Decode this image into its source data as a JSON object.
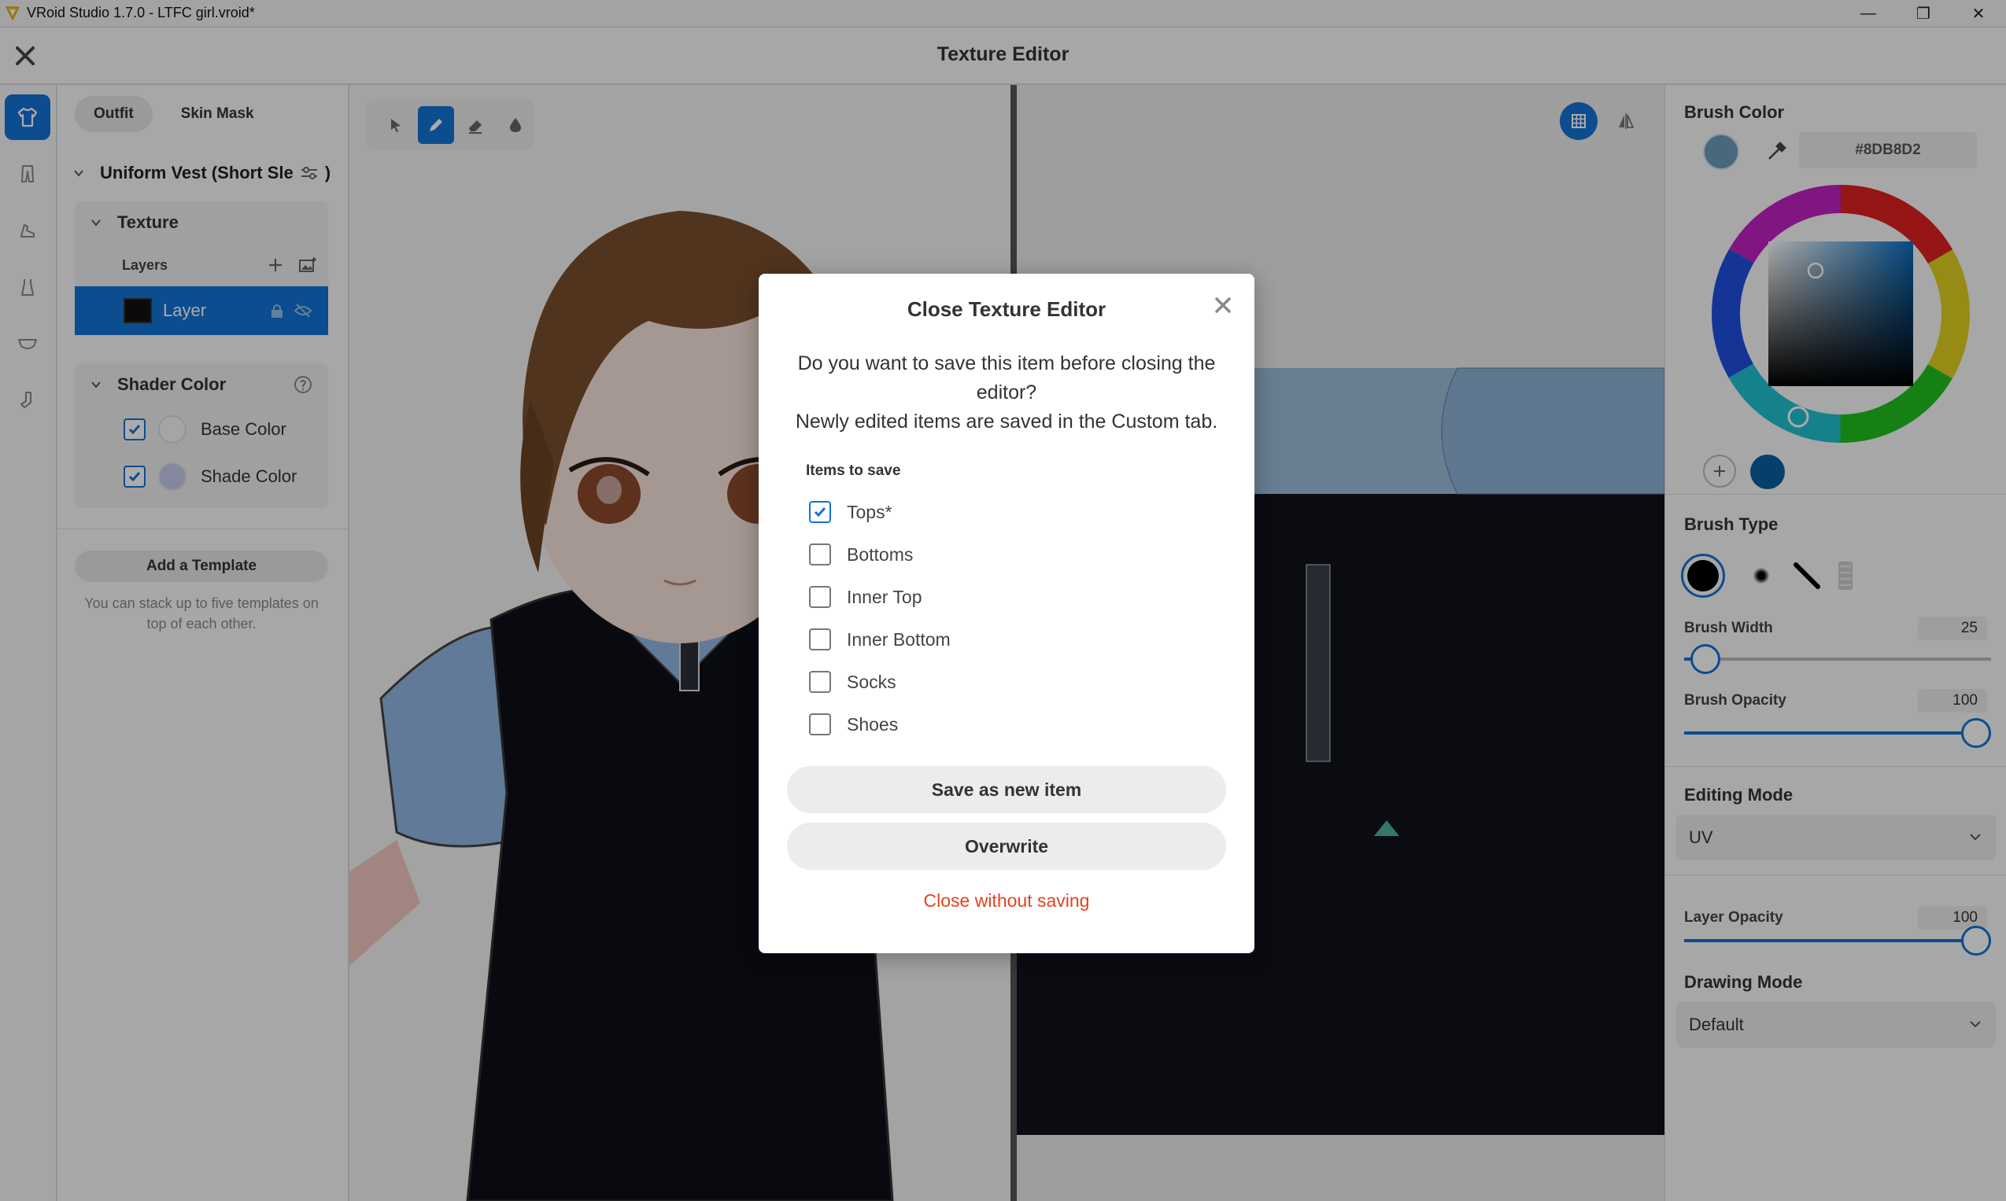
{
  "window": {
    "title": "VRoid Studio 1.7.0 - LTFC girl.vroid*",
    "minimize": "—",
    "maximize": "❐",
    "close": "✕"
  },
  "header": {
    "title": "Texture Editor"
  },
  "rail": {
    "items": [
      "shirt-icon",
      "pants-icon",
      "shoe-icon",
      "dress-icon",
      "bra-icon",
      "sock-icon"
    ]
  },
  "left_panel": {
    "tabs": [
      {
        "label": "Outfit",
        "active": true
      },
      {
        "label": "Skin Mask",
        "active": false
      }
    ],
    "item_title": "Uniform Vest (Short Sle",
    "item_title_suffix": ")",
    "texture": {
      "title": "Texture",
      "layers_label": "Layers",
      "layer_name": "Layer"
    },
    "shader": {
      "title": "Shader Color",
      "rows": [
        {
          "label": "Base Color",
          "checked": true,
          "color": "#f6f6f6"
        },
        {
          "label": "Shade Color",
          "checked": true,
          "color": "#c7c9ed"
        }
      ]
    },
    "add_template": "Add a Template",
    "template_note": "You can stack up to five templates on top of each other."
  },
  "toolbar": {
    "tools": [
      "select-icon",
      "pen-icon",
      "eraser-icon",
      "fill-icon"
    ],
    "active": "pen-icon"
  },
  "right_panel": {
    "brush_color": {
      "title": "Brush Color",
      "hex": "#8DB8D2",
      "current_color": "#6c9bb8",
      "saved_color": "#0b5fa0"
    },
    "brush_type": {
      "title": "Brush Type"
    },
    "brush_width": {
      "label": "Brush Width",
      "value": "25",
      "fraction": 0.07
    },
    "brush_opacity": {
      "label": "Brush Opacity",
      "value": "100",
      "fraction": 1.0
    },
    "editing_mode": {
      "title": "Editing Mode",
      "value": "UV"
    },
    "layer_opacity": {
      "label": "Layer Opacity",
      "value": "100",
      "fraction": 1.0
    },
    "drawing_mode": {
      "title": "Drawing Mode",
      "value": "Default"
    }
  },
  "dialog": {
    "title": "Close Texture Editor",
    "message_line1": "Do you want to save this item before closing the editor?",
    "message_line2": "Newly edited items are saved in the Custom tab.",
    "items_label": "Items to save",
    "items": [
      {
        "label": "Tops*",
        "checked": true
      },
      {
        "label": "Bottoms",
        "checked": false
      },
      {
        "label": "Inner Top",
        "checked": false
      },
      {
        "label": "Inner Bottom",
        "checked": false
      },
      {
        "label": "Socks",
        "checked": false
      },
      {
        "label": "Shoes",
        "checked": false
      }
    ],
    "save_new": "Save as new item",
    "overwrite": "Overwrite",
    "close_without": "Close without saving"
  },
  "colors": {
    "accent": "#1173d4",
    "danger": "#e2431f"
  }
}
